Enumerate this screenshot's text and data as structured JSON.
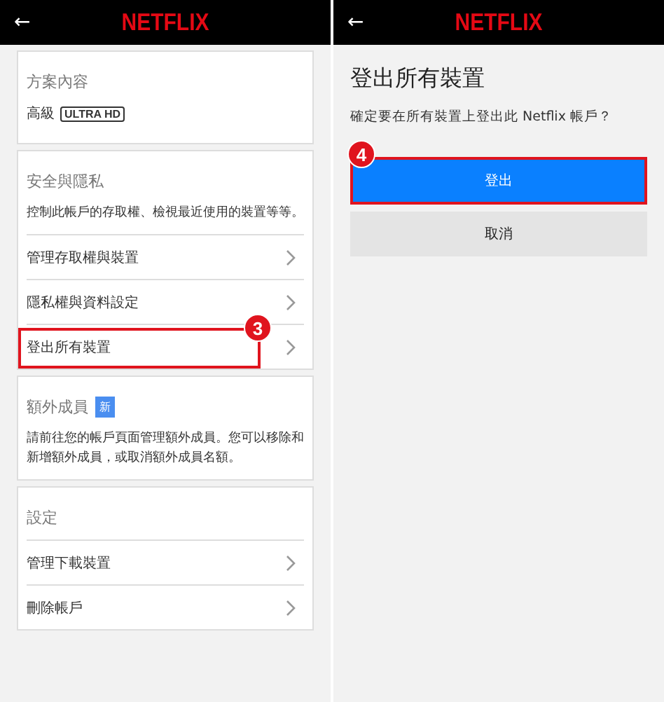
{
  "panels": [
    {
      "kind": "account",
      "header": {
        "back": "←",
        "logo": "NETFLIX"
      },
      "cards": [
        {
          "title": "方案內容",
          "plan": {
            "tier": "高級",
            "badge": "ULTRA HD"
          }
        },
        {
          "title": "安全與隱私",
          "description": "控制此帳戶的存取權、檢視最近使用的裝置等等。",
          "rows": [
            {
              "label": "管理存取權與裝置"
            },
            {
              "label": "隱私權與資料設定"
            },
            {
              "label": "登出所有裝置",
              "callout": "3"
            }
          ]
        },
        {
          "title": "額外成員",
          "tag": "新",
          "description": "請前往您的帳戶頁面管理額外成員。您可以移除和新增額外成員，或取消額外成員名額。"
        },
        {
          "title": "設定",
          "rows": [
            {
              "label": "管理下載裝置"
            },
            {
              "label": "刪除帳戶"
            }
          ]
        }
      ]
    },
    {
      "kind": "confirm",
      "header": {
        "back": "←",
        "logo": "NETFLIX"
      },
      "title": "登出所有裝置",
      "message": "確定要在所有裝置上登出此 Netflix 帳戶？",
      "buttons": [
        {
          "label": "登出",
          "kind": "primary",
          "callout": "4"
        },
        {
          "label": "取消",
          "kind": "secondary"
        }
      ]
    }
  ]
}
